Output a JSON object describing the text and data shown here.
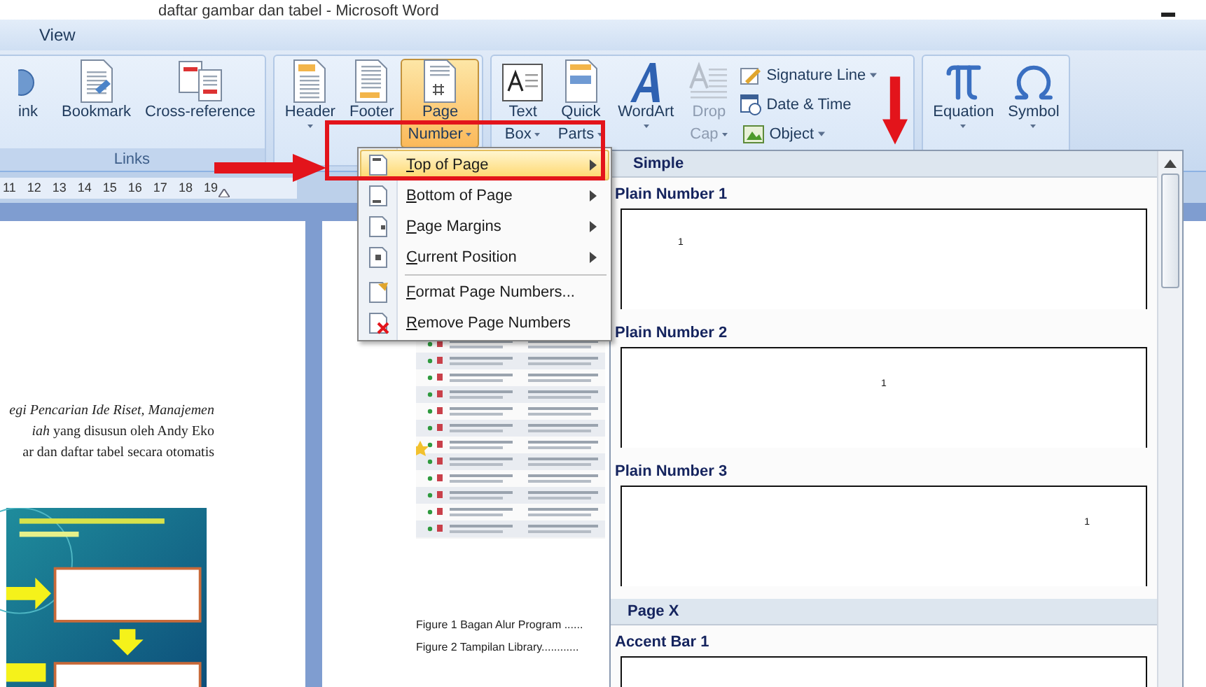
{
  "window": {
    "title": "daftar gambar dan tabel - Microsoft Word"
  },
  "tabs": [
    {
      "label": "View",
      "selected": false
    }
  ],
  "ribbon": {
    "groups": [
      {
        "label": "Links",
        "large": [
          {
            "lines": [
              "ink"
            ],
            "dropdown": false,
            "active": false,
            "disabled": false
          },
          {
            "lines": [
              "Bookmark"
            ],
            "dropdown": false,
            "active": false,
            "disabled": false
          },
          {
            "lines": [
              "Cross-reference"
            ],
            "dropdown": false,
            "active": false,
            "disabled": false
          }
        ]
      },
      {
        "large": [
          {
            "lines": [
              "Header"
            ],
            "dropdown": true,
            "active": false,
            "disabled": false
          },
          {
            "lines": [
              "Footer"
            ],
            "active": false,
            "disabled": false
          },
          {
            "lines": [
              "Page",
              "Number"
            ],
            "dropdown": true,
            "active": true,
            "disabled": false
          }
        ]
      },
      {
        "large": [
          {
            "lines": [
              "Text",
              "Box"
            ],
            "dropdown": true,
            "active": false,
            "disabled": false
          },
          {
            "lines": [
              "Quick",
              "Parts"
            ],
            "dropdown": true,
            "active": false,
            "disabled": false
          },
          {
            "lines": [
              "WordArt"
            ],
            "dropdown": true,
            "active": false,
            "disabled": false
          },
          {
            "lines": [
              "Drop",
              "Cap"
            ],
            "dropdown": true,
            "active": false,
            "disabled": true
          }
        ],
        "small": [
          {
            "label": "Signature Line",
            "dropdown": true
          },
          {
            "label": "Date & Time",
            "dropdown": false
          },
          {
            "label": "Object",
            "dropdown": true
          }
        ]
      },
      {
        "large": [
          {
            "lines": [
              "Equation"
            ],
            "dropdown": true,
            "active": false,
            "disabled": false
          },
          {
            "lines": [
              "Symbol"
            ],
            "dropdown": true,
            "active": false,
            "disabled": false
          }
        ]
      }
    ]
  },
  "ruler": {
    "numbers": [
      "11",
      "12",
      "13",
      "14",
      "15",
      "16",
      "17",
      "18",
      "19"
    ]
  },
  "document": {
    "left_page": {
      "lines": [
        "*egi Pencarian Ide Riset, Manajemen*",
        "*iah* yang disusun oleh Andy Eko",
        "ar dan daftar tabel secara otomatis"
      ]
    },
    "right_page": {
      "figures": [
        "Figure 1 Bagan Alur Program ......",
        "Figure 2 Tampilan Library............"
      ]
    }
  },
  "page_number_menu": {
    "items": [
      {
        "label": "Top of Page",
        "submenu": true,
        "selected": true
      },
      {
        "label": "Bottom of Page",
        "submenu": true,
        "selected": false
      },
      {
        "label": "Page Margins",
        "submenu": true,
        "selected": false
      },
      {
        "label": "Current Position",
        "submenu": true,
        "selected": false
      },
      {
        "label": "Format Page Numbers...",
        "submenu": false,
        "selected": false
      },
      {
        "label": "Remove Page Numbers",
        "submenu": false,
        "selected": false
      }
    ]
  },
  "gallery": {
    "entries": [
      {
        "kind": "header",
        "label": "Simple"
      },
      {
        "kind": "preview",
        "label": "Plain Number 1",
        "number": "1"
      },
      {
        "kind": "preview",
        "label": "Plain Number 2",
        "number": "1"
      },
      {
        "kind": "preview",
        "label": "Plain Number 3",
        "number": "1"
      },
      {
        "kind": "header",
        "label": "Page X"
      },
      {
        "kind": "preview",
        "label": "Accent Bar 1"
      }
    ]
  }
}
